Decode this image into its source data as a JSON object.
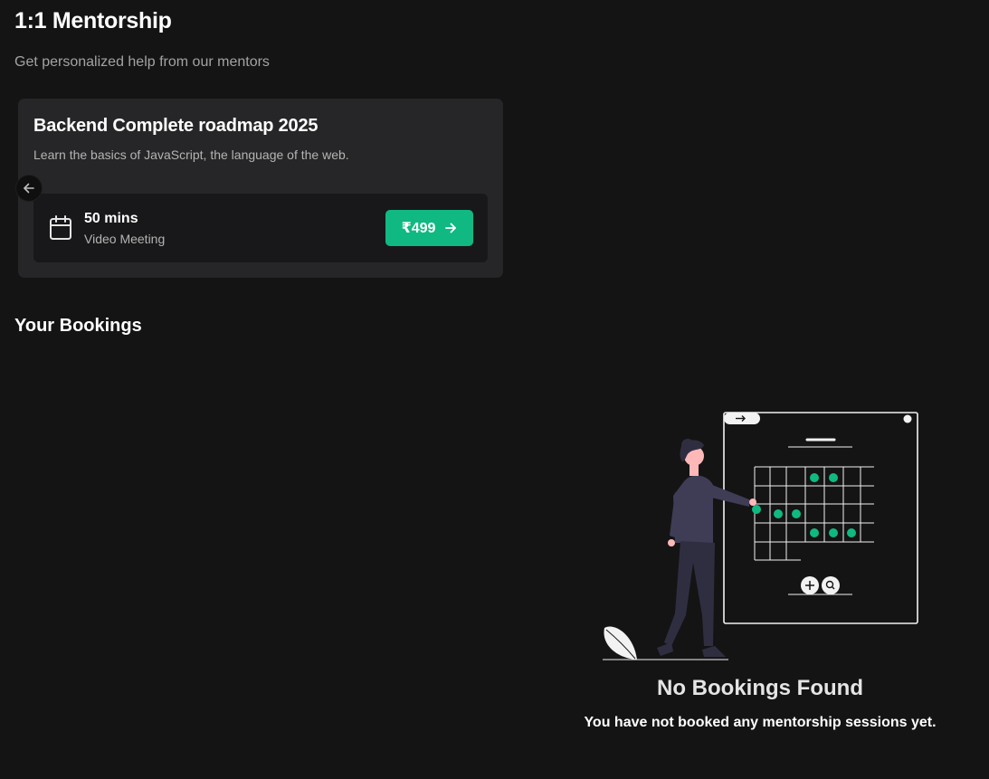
{
  "header": {
    "title": "1:1 Mentorship",
    "subtitle": "Get personalized help from our mentors"
  },
  "mentorship_card": {
    "title": "Backend Complete roadmap 2025",
    "description": "Learn the basics of JavaScript, the language of the web.",
    "duration": "50 mins",
    "meeting_type": "Video Meeting",
    "price": "₹499",
    "icon": "calendar-icon"
  },
  "bookings": {
    "title": "Your Bookings",
    "empty_title": "No Bookings Found",
    "empty_message": "You have not booked any mentorship sessions yet."
  },
  "colors": {
    "background": "#141414",
    "card": "#262628",
    "card_inner": "#18181a",
    "accent": "#10b981",
    "figure": "#3f3d56"
  }
}
